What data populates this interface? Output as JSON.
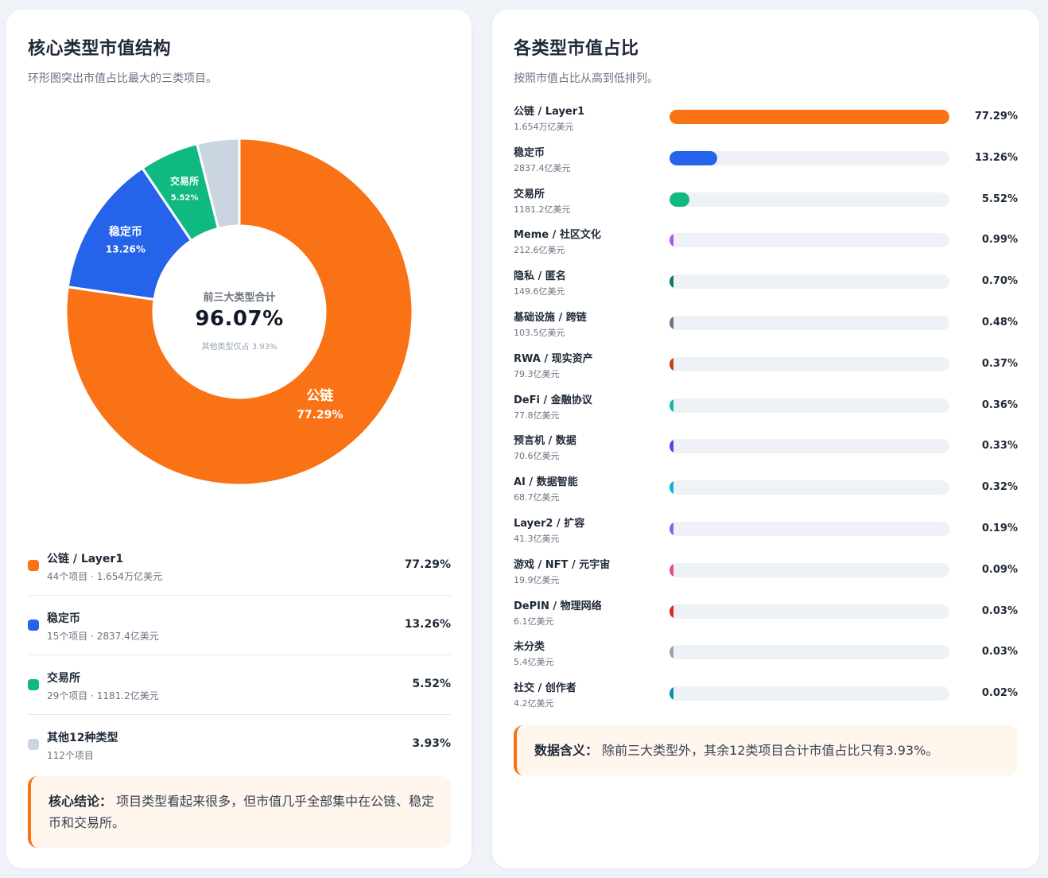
{
  "left": {
    "title": "核心类型市值结构",
    "subtitle": "环形图突出市值占比最大的三类项目。",
    "center_label": "前三大类型合计",
    "center_value": "96.07%",
    "center_note": "其他类型仅占 3.93%",
    "legend": [
      {
        "name": "公链 / Layer1",
        "meta": "44个项目 · 1.654万亿美元",
        "pct": "77.29%",
        "color": "#f97316"
      },
      {
        "name": "稳定币",
        "meta": "15个项目 · 2837.4亿美元",
        "pct": "13.26%",
        "color": "#2563eb"
      },
      {
        "name": "交易所",
        "meta": "29个项目 · 1181.2亿美元",
        "pct": "5.52%",
        "color": "#10b981"
      },
      {
        "name": "其他12种类型",
        "meta": "112个项目",
        "pct": "3.93%",
        "color": "#cbd5e1"
      }
    ],
    "conclusion_label": "核心结论：",
    "conclusion_text": "项目类型看起来很多，但市值几乎全部集中在公链、稳定币和交易所。"
  },
  "right": {
    "title": "各类型市值占比",
    "subtitle": "按照市值占比从高到低排列。",
    "meaning_label": "数据含义：",
    "meaning_text": "除前三大类型外，其余12类项目合计市值占比只有3.93%。"
  },
  "chart_data": [
    {
      "type": "pie",
      "donut": true,
      "categories": [
        "公链",
        "稳定币",
        "交易所",
        "其他12种类型"
      ],
      "values": [
        77.29,
        13.26,
        5.52,
        3.93
      ],
      "value_labels": [
        "77.29%",
        "13.26%",
        "5.52%",
        ""
      ],
      "colors": [
        "#f97316",
        "#2563eb",
        "#10b981",
        "#cbd5e1"
      ]
    },
    {
      "type": "bar",
      "orientation": "horizontal",
      "xlim": [
        0,
        77.29
      ],
      "categories": [
        "公链 / Layer1",
        "稳定币",
        "交易所",
        "Meme / 社区文化",
        "隐私 / 匿名",
        "基础设施 / 跨链",
        "RWA / 现实资产",
        "DeFi / 金融协议",
        "预言机 / 数据",
        "AI / 数据智能",
        "Layer2 / 扩容",
        "游戏 / NFT / 元宇宙",
        "DePIN / 物理网络",
        "未分类",
        "社交 / 创作者"
      ],
      "market_caps": [
        "1.654万亿美元",
        "2837.4亿美元",
        "1181.2亿美元",
        "212.6亿美元",
        "149.6亿美元",
        "103.5亿美元",
        "79.3亿美元",
        "77.8亿美元",
        "70.6亿美元",
        "68.7亿美元",
        "41.3亿美元",
        "19.9亿美元",
        "6.1亿美元",
        "5.4亿美元",
        "4.2亿美元"
      ],
      "values": [
        77.29,
        13.26,
        5.52,
        0.99,
        0.7,
        0.48,
        0.37,
        0.36,
        0.33,
        0.32,
        0.19,
        0.09,
        0.03,
        0.03,
        0.02
      ],
      "value_labels": [
        "77.29%",
        "13.26%",
        "5.52%",
        "0.99%",
        "0.70%",
        "0.48%",
        "0.37%",
        "0.36%",
        "0.33%",
        "0.32%",
        "0.19%",
        "0.09%",
        "0.03%",
        "0.03%",
        "0.02%"
      ],
      "colors": [
        "#f97316",
        "#2563eb",
        "#10b981",
        "#a855f7",
        "#0f766e",
        "#64748b",
        "#c2410c",
        "#14b8a6",
        "#4f46e5",
        "#06b6d4",
        "#8b5cf6",
        "#ec4899",
        "#dc2626",
        "#94a3b8",
        "#0891b2"
      ]
    }
  ]
}
